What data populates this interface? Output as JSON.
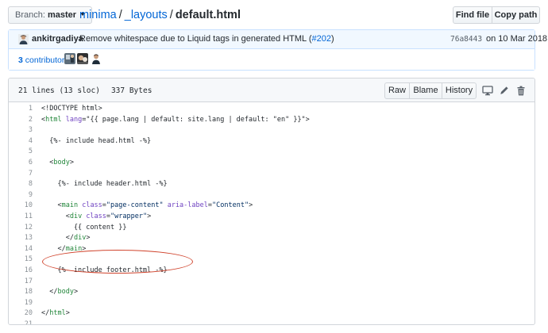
{
  "topbar": {
    "branch_prefix": "Branch:",
    "branch_name": "master",
    "repo": "minima",
    "folder": "_layouts",
    "separator": "/",
    "file_name": "default.html",
    "find_file_label": "Find file",
    "copy_path_label": "Copy path"
  },
  "commit": {
    "author": "ankitrgadiya",
    "message": "Remove whitespace due to Liquid tags in generated HTML (",
    "pr_link": "#202",
    "message_end": ")",
    "sha": "76a8443",
    "date": "on 10 Mar 2018"
  },
  "contributors": {
    "count": "3",
    "label": "contributors"
  },
  "file": {
    "lines_info": "21 lines (13 sloc)",
    "size": "337 Bytes",
    "raw_label": "Raw",
    "blame_label": "Blame",
    "history_label": "History",
    "icons": [
      "desktop-icon",
      "pencil-icon",
      "trash-icon"
    ]
  },
  "code_lines": [
    {
      "n": "1",
      "text": "<!DOCTYPE html>"
    },
    {
      "n": "2",
      "text": "<html lang=\"{{ page.lang | default: site.lang | default: \"en\" }}\">"
    },
    {
      "n": "3",
      "text": ""
    },
    {
      "n": "4",
      "text": "  {%- include head.html -%}"
    },
    {
      "n": "5",
      "text": ""
    },
    {
      "n": "6",
      "text": "  <body>"
    },
    {
      "n": "7",
      "text": ""
    },
    {
      "n": "8",
      "text": "    {%- include header.html -%}"
    },
    {
      "n": "9",
      "text": ""
    },
    {
      "n": "10",
      "text": "    <main class=\"page-content\" aria-label=\"Content\">"
    },
    {
      "n": "11",
      "text": "      <div class=\"wrapper\">"
    },
    {
      "n": "12",
      "text": "        {{ content }}"
    },
    {
      "n": "13",
      "text": "      </div>"
    },
    {
      "n": "14",
      "text": "    </main>"
    },
    {
      "n": "15",
      "text": ""
    },
    {
      "n": "16",
      "text": "    {%- include footer.html -%}"
    },
    {
      "n": "17",
      "text": ""
    },
    {
      "n": "18",
      "text": "  </body>"
    },
    {
      "n": "19",
      "text": ""
    },
    {
      "n": "20",
      "text": "</html>"
    },
    {
      "n": "21",
      "text": ""
    }
  ],
  "colors": {
    "link": "#0366d6",
    "tag": "#22863a",
    "attr": "#6f42c1",
    "string": "#032f62",
    "annotation": "#d0432c"
  }
}
